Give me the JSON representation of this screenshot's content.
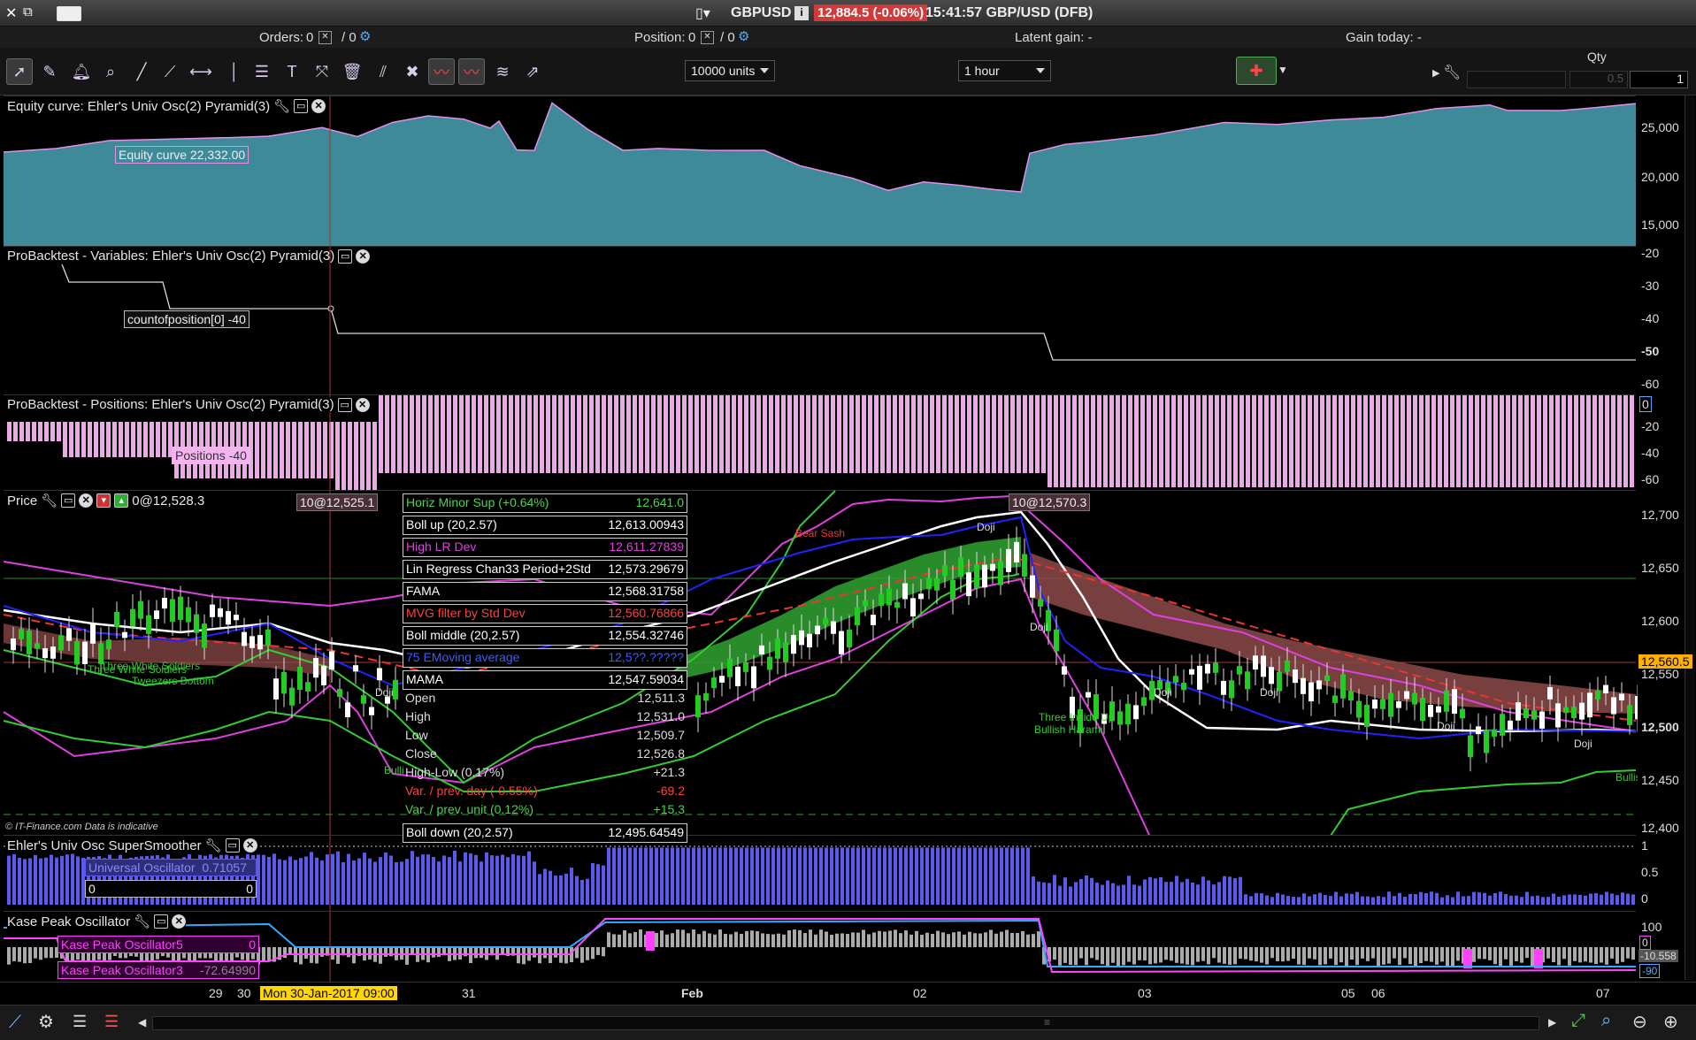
{
  "titlebar": {
    "symbol": "GBPUSD",
    "price_badge": "12,884.5 (-0.06%)",
    "time_info": "15:41:57 GBP/USD (DFB)"
  },
  "infobar": {
    "orders_label": "Orders:",
    "orders_value": "0",
    "orders_slash": "/ 0",
    "position_label": "Position:",
    "position_value": "0",
    "position_slash": "/ 0",
    "latent_gain": "Latent gain: -",
    "gain_today": "Gain today: -"
  },
  "toolbar": {
    "units_select": "10000 units",
    "interval_select": "1 hour",
    "qty_label": "Qty",
    "qty_input_1": "0.5",
    "qty_input_2": "1"
  },
  "panels": {
    "equity": {
      "title": "Equity curve: Ehler's Univ Osc(2) Pyramid(3)",
      "tag": "Equity curve  22,332.00",
      "scale": [
        "25,000",
        "20,000",
        "15,000"
      ]
    },
    "variables": {
      "title": "ProBacktest - Variables: Ehler's Univ Osc(2) Pyramid(3)",
      "tag": "countofposition[0]  -40",
      "scale": [
        "-20",
        "-30",
        "-40",
        "-50",
        "-60"
      ]
    },
    "positions": {
      "title": "ProBacktest - Positions: Ehler's Univ Osc(2) Pyramid(3)",
      "tag": "Positions  -40",
      "scale": [
        "0",
        "-20",
        "-40",
        "-60"
      ]
    },
    "price": {
      "title": "Price",
      "price_tag": "0@12,528.3",
      "order_tag_1": "10@12,525.1",
      "order_tag_2": "10@12,570.3",
      "current_price": "12,560.5",
      "scale": [
        "12,700",
        "12,650",
        "12,600",
        "12,550",
        "12,500",
        "12,450",
        "12,400"
      ],
      "copyright": "© IT-Finance.com  Data is indicative",
      "patterns": [
        "Bear Sash",
        "Doji",
        "Doji",
        "Doji",
        "Doji",
        "Doji",
        "Doji",
        "Doji",
        "Three White Soldiers",
        "Three White Soldiers",
        "Tweezers Bottom",
        "Three Inside Up",
        "Bullish Harami",
        "Bulli",
        "Bullis"
      ]
    },
    "ehlers": {
      "title": "Ehler's Univ Osc SuperSmoother",
      "tag_name": "Universal Oscillator",
      "tag_value": "0.71057",
      "zero_left": "0",
      "zero_right": "0",
      "scale": [
        "1",
        "0.5",
        "0"
      ]
    },
    "kase": {
      "title": "Kase Peak Oscillator",
      "tag1_name": "Kase Peak Oscillator5",
      "tag1_value": "0",
      "tag2_name": "Kase Peak Oscillator3",
      "tag2_value": "-72.64990",
      "scale": [
        "100",
        "0",
        "-10.558",
        "-90"
      ]
    }
  },
  "infobox": [
    {
      "label": "Horiz Minor Sup (+0.64%)",
      "value": "12,641.0",
      "color": "#4cd44c"
    },
    {
      "label": "Boll up (20,2.57)",
      "value": "12,613.00943",
      "color": "#ffffff"
    },
    {
      "label": "High LR Dev",
      "value": "12,611.27839",
      "color": "#e040e0"
    },
    {
      "label": "Lin Regress Chan33 Period+2Std",
      "value": "12,573.29679",
      "color": "#ffffff"
    },
    {
      "label": "FAMA",
      "value": "12,568.31758",
      "color": "#ffffff"
    },
    {
      "label": "MVG filter by Std Dev",
      "value": "12,560.76866",
      "color": "#ff4040"
    },
    {
      "label": "Boll middle (20,2.57)",
      "value": "12,554.32746",
      "color": "#ffffff"
    },
    {
      "label": "75 EMoving average",
      "value": "12,5??.?????",
      "color": "#3a5cff"
    },
    {
      "label": "MAMA",
      "value": "12,547.59034",
      "color": "#ffffff"
    }
  ],
  "ohlc": [
    {
      "label": "Open",
      "value": "12,511.3",
      "color": "#dddddd"
    },
    {
      "label": "High",
      "value": "12,531.0",
      "color": "#dddddd"
    },
    {
      "label": "Low",
      "value": "12,509.7",
      "color": "#dddddd"
    },
    {
      "label": "Close",
      "value": "12,526.8",
      "color": "#dddddd"
    },
    {
      "label": "High-Low (0.17%)",
      "value": "+21.3",
      "color": "#dddddd"
    },
    {
      "label": "Var. / prev. day (-0.55%)",
      "value": "-69.2",
      "color": "#ff4040"
    },
    {
      "label": "Var. / prev. unit (0.12%)",
      "value": "+15.3",
      "color": "#4cd44c"
    }
  ],
  "boll_down": {
    "label": "Boll down (20,2.57)",
    "value": "12,495.64549"
  },
  "xaxis": {
    "labels": [
      "29",
      "30",
      "31",
      "Feb",
      "02",
      "03",
      "05",
      "06",
      "07"
    ],
    "cursor_label": "Mon 30-Jan-2017 09:00"
  },
  "colors": {
    "equity_fill": "#3e8a99",
    "equity_line": "#e58fe8",
    "positions_bar": "#f4b4f0",
    "ehlers_bar": "#5a5af0",
    "kase_bar": "#aaaaaa",
    "kase_peak": "#ff40ff",
    "cloud_green": "#2f9a2f",
    "cloud_red": "#8c4a48",
    "badge_red": "#d23a3a"
  },
  "icons": [
    "close-icon",
    "restore-icon",
    "keyboard-icon",
    "pointer-icon",
    "ruler-icon",
    "alarm-icon",
    "zoom-icon",
    "line-icon",
    "trendline-icon",
    "horizontal-line-icon",
    "vertical-line-icon",
    "fibonacci-icon",
    "text-icon",
    "cross-icon",
    "trash-icon",
    "multi-line-icon",
    "tools-icon",
    "indicator-icon",
    "indicator2-icon",
    "layers-icon",
    "signal-icon",
    "buy-sell-icon",
    "wrench-icon"
  ]
}
